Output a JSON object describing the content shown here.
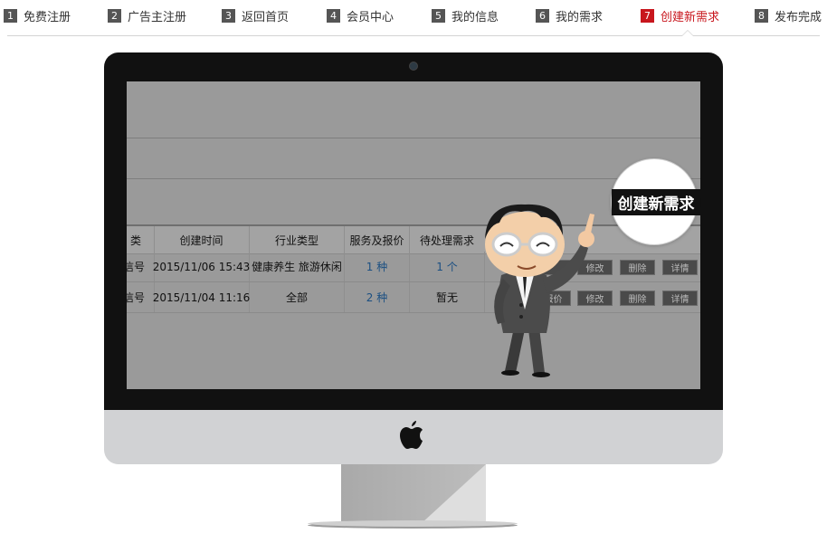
{
  "steps": [
    {
      "num": "1",
      "label": "免费注册"
    },
    {
      "num": "2",
      "label": "广告主注册"
    },
    {
      "num": "3",
      "label": "返回首页"
    },
    {
      "num": "4",
      "label": "会员中心"
    },
    {
      "num": "5",
      "label": "我的信息"
    },
    {
      "num": "6",
      "label": "我的需求"
    },
    {
      "num": "7",
      "label": "创建新需求"
    },
    {
      "num": "8",
      "label": "发布完成"
    }
  ],
  "active_step": "7",
  "colors": {
    "accent": "#c8161d",
    "step_box": "#555555",
    "screen": "#9a9a9a"
  },
  "screen": {
    "table": {
      "headers": [
        "类",
        "创建时间",
        "行业类型",
        "服务及报价",
        "待处理需求"
      ],
      "rows": [
        {
          "cat": "信号",
          "created": "2015/11/06 15:43",
          "industry": "健康养生 旅游休闲",
          "service": "1 种",
          "pending": "1 个"
        },
        {
          "cat": "信号",
          "created": "2015/11/04 11:16",
          "industry": "全部",
          "service": "2 种",
          "pending": "暂无"
        }
      ],
      "row1_actions": {
        "partial": "",
        "edit": "修改",
        "delete": "删除",
        "detail": "详情"
      },
      "row2_actions": {
        "partial": "报价",
        "edit": "修改",
        "delete": "删除",
        "detail": "详情"
      }
    },
    "callout": "创建新需求"
  },
  "icons": {
    "apple_logo": "apple-logo-icon"
  }
}
